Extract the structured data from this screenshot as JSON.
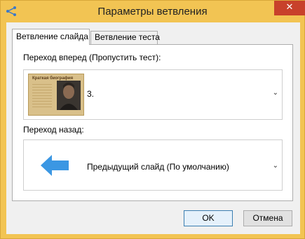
{
  "window": {
    "title": "Параметры ветвления",
    "close_glyph": "✕"
  },
  "tabs": [
    {
      "label": "Ветвление слайда",
      "active": true
    },
    {
      "label": "Ветвление теста",
      "active": false
    }
  ],
  "forward": {
    "label": "Переход вперед (Пропустить тест):",
    "value": "3.",
    "thumbnail_icon": "slide-thumbnail",
    "thumb_title": "Краткая биография"
  },
  "back": {
    "label": "Переход назад:",
    "value": "Предыдущий слайд (По умолчанию)",
    "icon": "arrow-left-icon",
    "icon_color": "#3b97e3"
  },
  "buttons": {
    "ok": "OK",
    "cancel": "Отмена"
  },
  "colors": {
    "title_bar": "#f2c453",
    "close_button": "#c8412b"
  },
  "chevron_glyph": "⌄"
}
